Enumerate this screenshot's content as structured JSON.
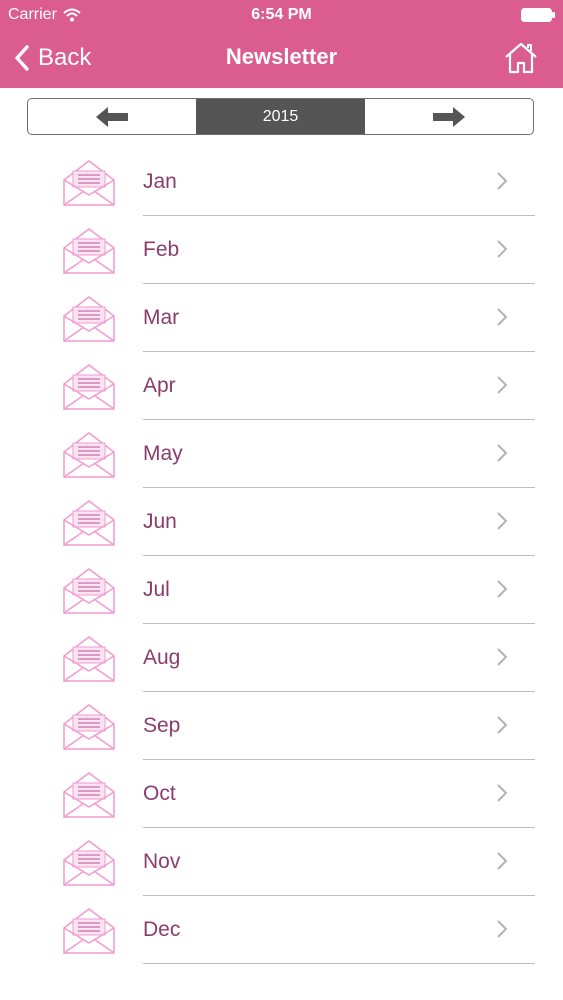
{
  "status_bar": {
    "carrier": "Carrier",
    "time": "6:54 PM"
  },
  "nav": {
    "back_label": "Back",
    "title": "Newsletter",
    "home_icon": "home-icon"
  },
  "year_selector": {
    "year": "2015",
    "prev_icon": "left-arrow-icon",
    "next_icon": "right-arrow-icon"
  },
  "months": [
    {
      "label": "Jan"
    },
    {
      "label": "Feb"
    },
    {
      "label": "Mar"
    },
    {
      "label": "Apr"
    },
    {
      "label": "May"
    },
    {
      "label": "Jun"
    },
    {
      "label": "Jul"
    },
    {
      "label": "Aug"
    },
    {
      "label": "Sep"
    },
    {
      "label": "Oct"
    },
    {
      "label": "Nov"
    },
    {
      "label": "Dec"
    }
  ],
  "colors": {
    "header": "#db5d8f",
    "month_text": "#8b3d6a",
    "envelope": "#f29ad0",
    "year_segment": "#555555"
  }
}
